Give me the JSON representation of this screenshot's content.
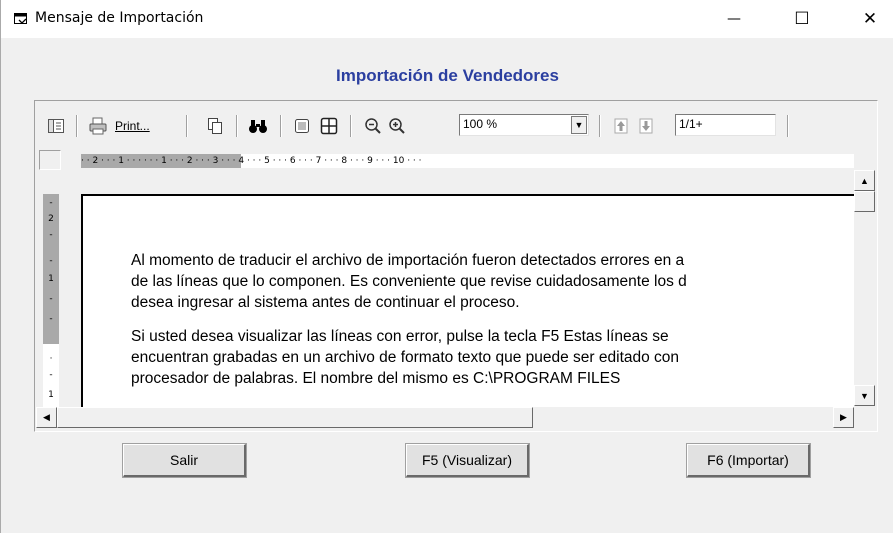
{
  "window": {
    "title": "Mensaje de Importación",
    "controls": {
      "minimize": "—",
      "maximize": "☐",
      "close": "✕"
    }
  },
  "heading": "Importación de Vendedores",
  "toolbar": {
    "print_label": "Print...",
    "zoom_value": "100 %",
    "page_value": "1/1+",
    "icons": [
      "toggle-tree-icon",
      "printer-icon",
      "copy-icon",
      "binoculars-icon",
      "single-page-icon",
      "multi-page-icon",
      "zoom-out-icon",
      "zoom-in-icon",
      "page-up-icon",
      "page-down-icon"
    ]
  },
  "ruler": {
    "horizontal": "· · 2 · · · 1 · · ·       · · · 1 · · · 2 · · · 3 · · · 4 · · · 5 · · · 6 · · · 7 · · · 8 · · · 9 · · · 10 · · ·",
    "vertical_marks": [
      "-",
      "2",
      "-",
      "-",
      "1",
      "-",
      "-",
      "·",
      "-",
      "1"
    ]
  },
  "document": {
    "paragraphs": [
      [
        "Al momento de traducir el archivo de importación fueron detectados errores en a",
        "de las líneas que lo componen. Es conveniente que revise cuidadosamente los d",
        "desea ingresar al sistema antes de   continuar el proceso."
      ],
      [
        "Si usted desea visualizar las líneas con error, pulse la tecla F5 Estas líneas se",
        "encuentran grabadas en un archivo de formato texto que puede ser editado con",
        "procesador de palabras. El nombre del mismo es C:\\PROGRAM FILES"
      ]
    ]
  },
  "buttons": {
    "salir": "Salir",
    "visualizar": "F5 (Visualizar)",
    "importar": "F6 (Importar)"
  }
}
